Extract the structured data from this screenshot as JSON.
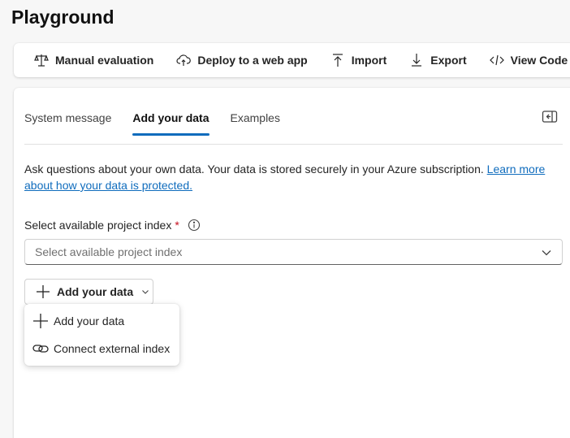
{
  "page": {
    "title": "Playground"
  },
  "toolbar": {
    "items": [
      {
        "label": "Manual evaluation",
        "icon": "scale-icon"
      },
      {
        "label": "Deploy to a web app",
        "icon": "cloud-upload-icon"
      },
      {
        "label": "Import",
        "icon": "arrow-up-icon"
      },
      {
        "label": "Export",
        "icon": "arrow-down-icon"
      },
      {
        "label": "View Code",
        "icon": "code-icon"
      }
    ]
  },
  "tabs": [
    {
      "label": "System message",
      "active": false
    },
    {
      "label": "Add your data",
      "active": true
    },
    {
      "label": "Examples",
      "active": false
    }
  ],
  "description": {
    "text": "Ask questions about your own data. Your data is stored securely in your Azure subscription. ",
    "link": "Learn more about how your data is protected."
  },
  "project_index": {
    "label": "Select available project index",
    "required_marker": "*",
    "placeholder": "Select available project index"
  },
  "add_data_button": {
    "label": "Add your data"
  },
  "dropdown_menu": {
    "items": [
      {
        "label": "Add your data",
        "icon": "plus-icon"
      },
      {
        "label": "Connect external index",
        "icon": "link-icon"
      }
    ]
  },
  "colors": {
    "accent": "#0f6cbd",
    "required": "#c50f1f",
    "background": "#f7f7f7"
  }
}
